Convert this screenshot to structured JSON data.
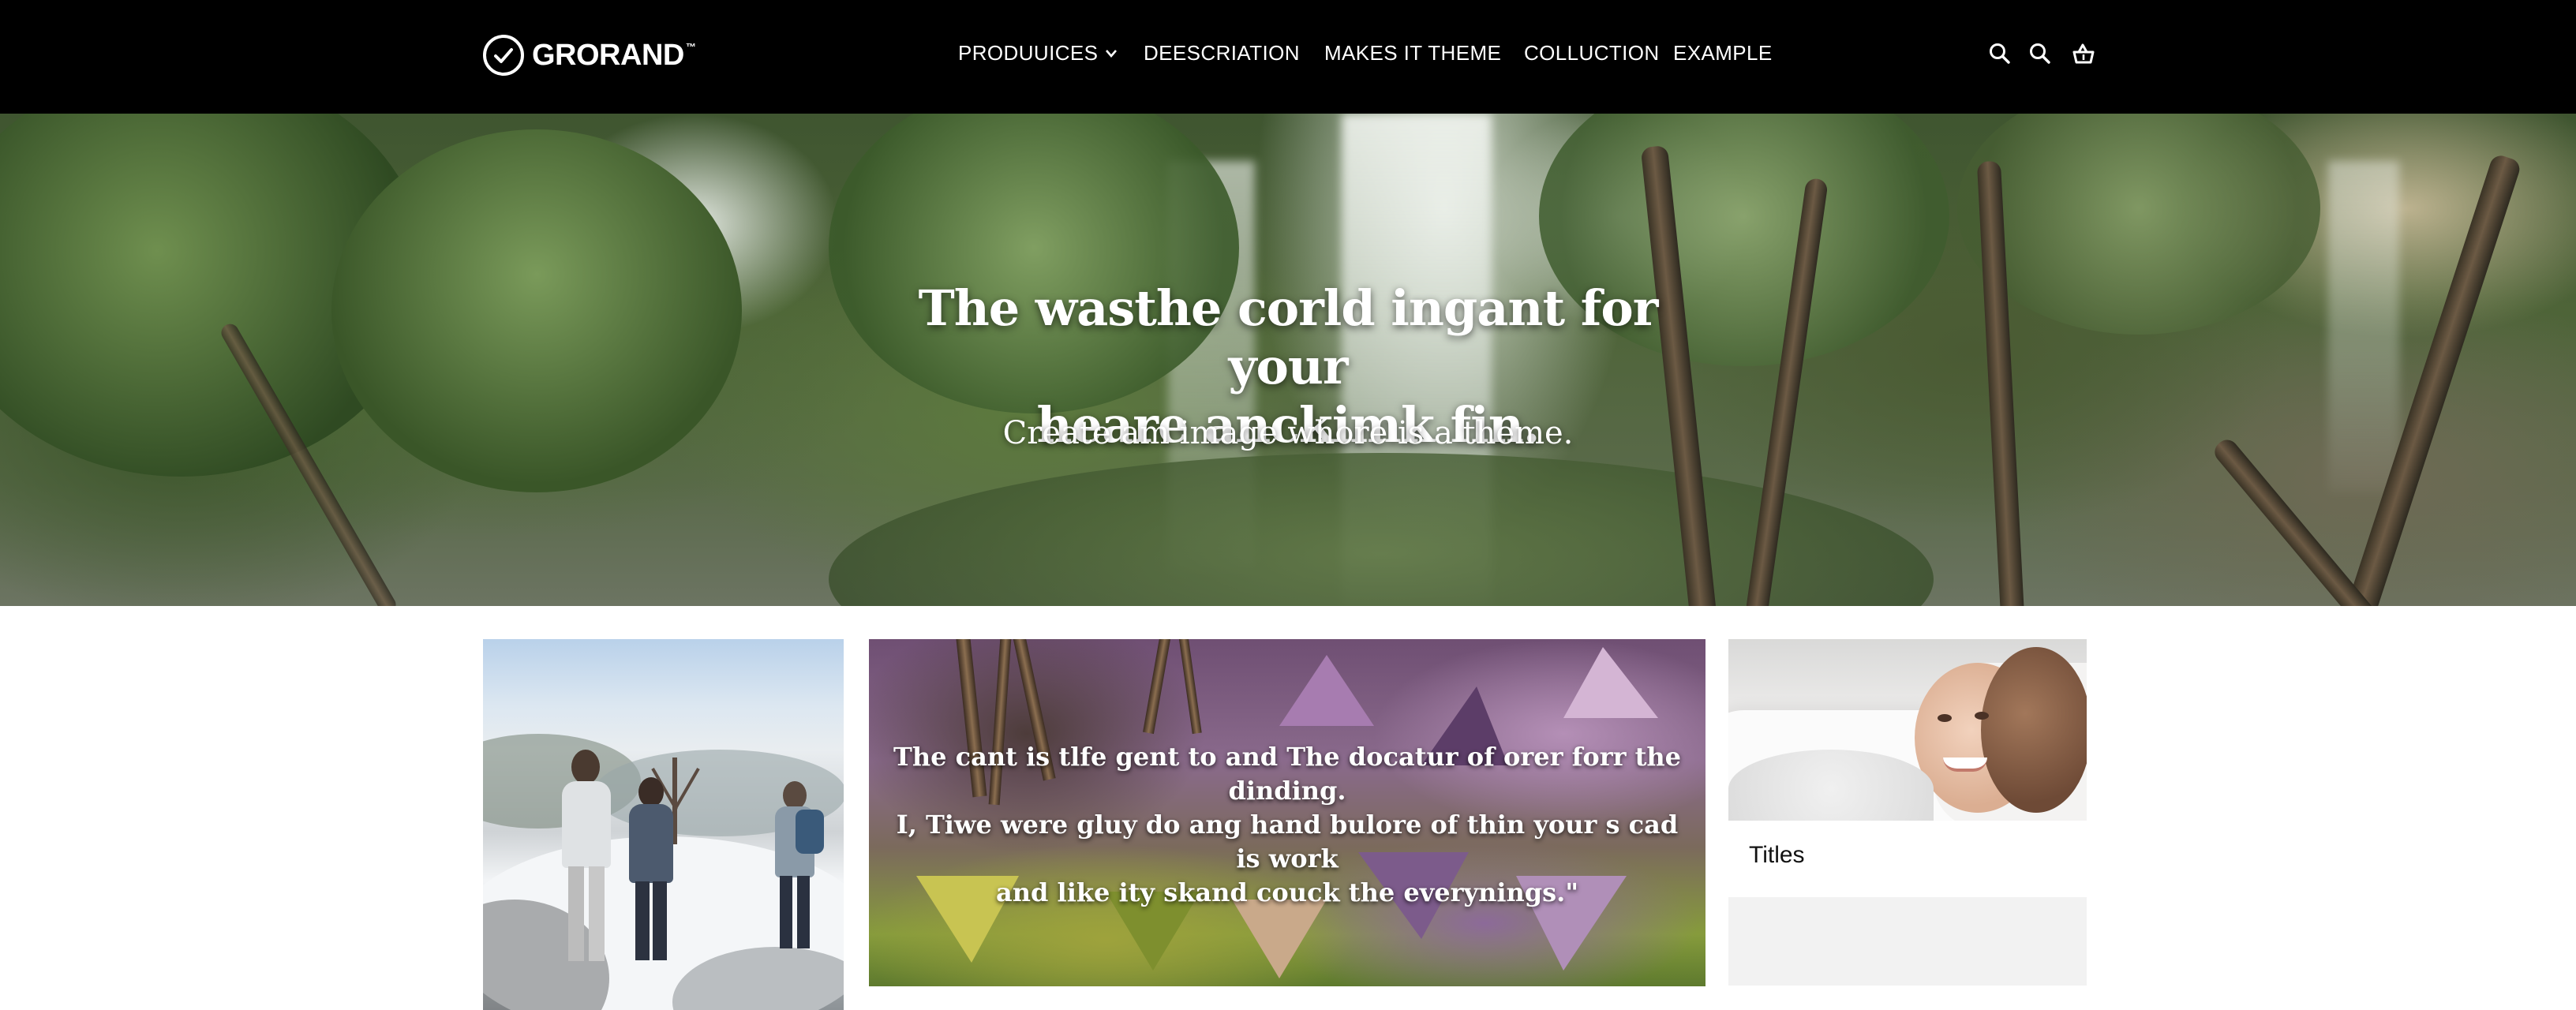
{
  "brand": {
    "name": "GRORAND",
    "trademark": "™"
  },
  "nav": {
    "items": [
      {
        "label": "PRODUUICES",
        "has_dropdown": true
      },
      {
        "label": "DEESCRIATION"
      },
      {
        "label": "MAKES IT THEME"
      },
      {
        "label": "COLLUCTION"
      },
      {
        "label": "EXAMPLE"
      }
    ],
    "icons": [
      "search-icon",
      "search-icon",
      "cart-icon"
    ]
  },
  "hero": {
    "title_line1": "The wasthe corld ingant for your",
    "title_line2": "heare anckimk fin.",
    "subtitle": "Create am image whore is a theme."
  },
  "cards": {
    "art_quote_line1": "The cant is tlfe gent to and The docatur of orer forr the dinding.",
    "art_quote_line2": "I, Tiwe were gluy do ang hand bulore of thin your s cad is work",
    "art_quote_line3": "and like ity skand couck the everynings.\"",
    "portrait_title": "Titles"
  },
  "colors": {
    "nav_bg": "#000000",
    "text_on_dark": "#ffffff",
    "page_bg": "#ffffff",
    "placeholder": "#f2f2f2"
  }
}
